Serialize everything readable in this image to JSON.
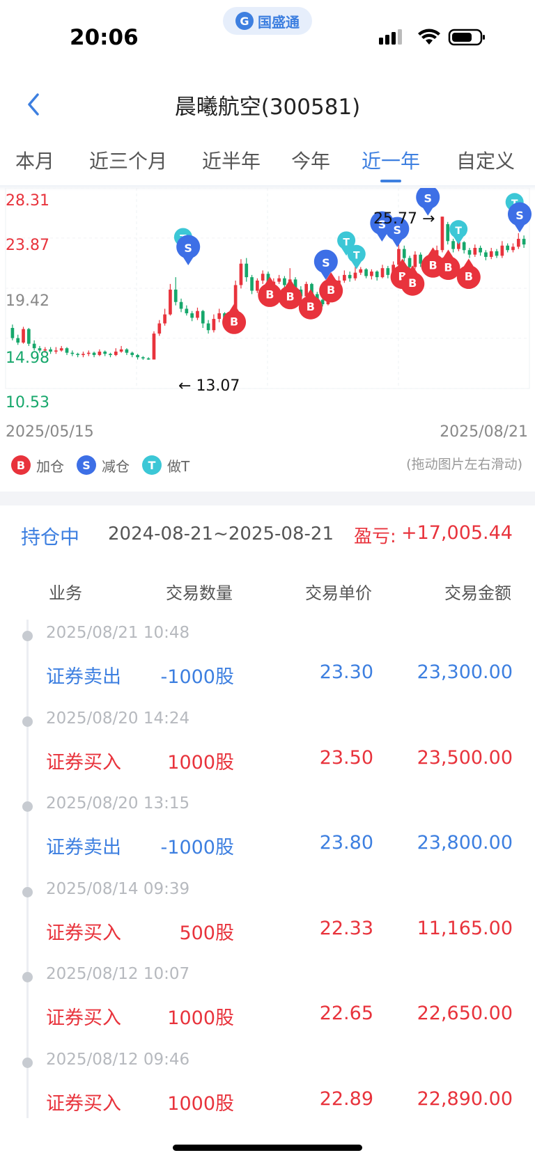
{
  "status_bar": {
    "time": "20:06",
    "carrier_logo": "G",
    "carrier_name": "国盛通",
    "icons": [
      "signal-icon",
      "wifi-icon",
      "battery-icon"
    ]
  },
  "header": {
    "title": "晨曦航空(300581)",
    "back_icon": "chevron-left-icon"
  },
  "tabs": [
    {
      "label": "本月",
      "active": false
    },
    {
      "label": "近三个月",
      "active": false
    },
    {
      "label": "近半年",
      "active": false
    },
    {
      "label": "今年",
      "active": false
    },
    {
      "label": "近一年",
      "active": true
    },
    {
      "label": "自定义",
      "active": false
    }
  ],
  "chart": {
    "y_labels": {
      "high": "28.31",
      "mid1": "23.87",
      "mid2": "19.42",
      "mid3": "14.98",
      "low": "10.53"
    },
    "date_start": "2025/05/15",
    "date_end": "2025/08/21",
    "high_callout": "25.77",
    "low_callout": "13.07",
    "drag_hint": "(拖动图片左右滑动)",
    "colors": {
      "up": "#e8333c",
      "down": "#16a76b",
      "buy": "#e8333c",
      "sell": "#3d6fe6",
      "t": "#3cc7d6"
    }
  },
  "chart_data": {
    "type": "candlestick",
    "x_range": [
      "2025/05/15",
      "2025/08/21"
    ],
    "ylim": [
      10.53,
      28.31
    ],
    "y_ticks": [
      28.31,
      23.87,
      19.42,
      14.98,
      10.53
    ],
    "candles": [
      [
        15.9,
        15.0,
        16.2,
        14.8
      ],
      [
        15.0,
        14.6,
        15.3,
        14.4
      ],
      [
        14.6,
        15.8,
        16.0,
        14.5
      ],
      [
        15.8,
        14.5,
        15.9,
        14.3
      ],
      [
        14.5,
        14.1,
        14.8,
        13.9
      ],
      [
        14.1,
        13.9,
        14.3,
        13.7
      ],
      [
        13.9,
        14.0,
        14.2,
        13.7
      ],
      [
        14.0,
        13.8,
        14.2,
        13.6
      ],
      [
        13.8,
        13.9,
        14.2,
        13.6
      ],
      [
        13.9,
        14.1,
        14.3,
        13.8
      ],
      [
        14.1,
        13.7,
        14.2,
        13.5
      ],
      [
        13.7,
        13.6,
        13.9,
        13.4
      ],
      [
        13.6,
        13.5,
        13.7,
        13.3
      ],
      [
        13.5,
        13.6,
        13.8,
        13.3
      ],
      [
        13.6,
        13.7,
        13.9,
        13.4
      ],
      [
        13.7,
        13.5,
        13.8,
        13.3
      ],
      [
        13.5,
        13.8,
        14.0,
        13.4
      ],
      [
        13.8,
        13.6,
        13.9,
        13.4
      ],
      [
        13.6,
        13.5,
        13.7,
        13.3
      ],
      [
        13.5,
        13.8,
        14.1,
        13.4
      ],
      [
        13.8,
        14.0,
        14.3,
        13.7
      ],
      [
        14.0,
        13.7,
        14.1,
        13.5
      ],
      [
        13.7,
        13.5,
        13.8,
        13.3
      ],
      [
        13.5,
        13.3,
        13.6,
        13.1
      ],
      [
        13.3,
        13.2,
        13.4,
        13.07
      ],
      [
        13.2,
        13.1,
        13.3,
        13.07
      ],
      [
        13.1,
        15.4,
        15.6,
        13.1
      ],
      [
        15.4,
        16.3,
        16.6,
        15.2
      ],
      [
        16.3,
        17.1,
        17.6,
        16.1
      ],
      [
        17.1,
        19.3,
        19.8,
        17.0
      ],
      [
        19.3,
        18.2,
        20.4,
        17.9
      ],
      [
        18.2,
        17.6,
        18.5,
        17.3
      ],
      [
        17.6,
        17.2,
        17.9,
        17.0
      ],
      [
        17.2,
        16.8,
        17.4,
        16.5
      ],
      [
        16.8,
        17.4,
        17.7,
        16.6
      ],
      [
        17.4,
        16.3,
        17.5,
        15.9
      ],
      [
        16.3,
        15.7,
        16.6,
        15.4
      ],
      [
        15.7,
        16.7,
        17.1,
        15.5
      ],
      [
        16.7,
        17.2,
        17.6,
        16.4
      ],
      [
        17.2,
        16.5,
        17.3,
        16.2
      ],
      [
        16.5,
        16.9,
        17.2,
        16.3
      ],
      [
        16.9,
        19.7,
        20.1,
        16.8
      ],
      [
        19.7,
        21.6,
        22.0,
        19.4
      ],
      [
        21.6,
        20.4,
        22.1,
        20.0
      ],
      [
        20.4,
        19.2,
        20.6,
        18.9
      ],
      [
        19.2,
        20.1,
        20.3,
        19.0
      ],
      [
        20.1,
        20.7,
        21.0,
        19.8
      ],
      [
        20.7,
        19.6,
        20.9,
        19.2
      ],
      [
        19.6,
        20.0,
        20.3,
        19.3
      ],
      [
        20.0,
        20.3,
        20.6,
        19.8
      ],
      [
        20.3,
        19.7,
        20.5,
        19.4
      ],
      [
        19.7,
        20.2,
        21.2,
        19.5
      ],
      [
        20.2,
        19.3,
        20.4,
        19.0
      ],
      [
        19.3,
        18.7,
        19.6,
        18.4
      ],
      [
        18.7,
        19.8,
        20.0,
        18.5
      ],
      [
        19.8,
        18.9,
        19.9,
        18.6
      ],
      [
        18.9,
        18.4,
        19.1,
        18.1
      ],
      [
        18.4,
        18.0,
        18.6,
        17.8
      ],
      [
        18.0,
        19.2,
        19.5,
        17.9
      ],
      [
        19.2,
        18.7,
        19.4,
        18.5
      ],
      [
        18.7,
        20.1,
        20.5,
        18.6
      ],
      [
        20.1,
        20.6,
        21.0,
        19.9
      ],
      [
        20.6,
        20.3,
        20.9,
        20.0
      ],
      [
        20.3,
        20.8,
        21.4,
        20.1
      ],
      [
        20.8,
        21.1,
        21.3,
        20.6
      ],
      [
        21.1,
        20.5,
        21.2,
        20.3
      ],
      [
        20.5,
        20.9,
        21.1,
        20.2
      ],
      [
        20.9,
        20.4,
        21.0,
        20.1
      ],
      [
        20.4,
        21.2,
        21.5,
        20.3
      ],
      [
        21.2,
        20.6,
        21.4,
        20.3
      ],
      [
        20.6,
        21.5,
        21.8,
        20.4
      ],
      [
        21.5,
        22.9,
        23.6,
        21.3
      ],
      [
        22.9,
        22.1,
        23.2,
        21.8
      ],
      [
        22.1,
        21.3,
        22.3,
        21.0
      ],
      [
        21.3,
        22.4,
        22.7,
        21.1
      ],
      [
        22.4,
        21.6,
        22.6,
        21.3
      ],
      [
        21.6,
        21.1,
        21.8,
        20.8
      ],
      [
        21.1,
        22.0,
        22.3,
        20.9
      ],
      [
        22.0,
        22.8,
        23.2,
        21.8
      ],
      [
        22.8,
        25.77,
        25.77,
        22.6
      ],
      [
        25.1,
        23.6,
        25.3,
        23.3
      ],
      [
        23.6,
        22.9,
        23.8,
        22.6
      ],
      [
        22.9,
        23.5,
        23.9,
        22.7
      ],
      [
        23.5,
        22.8,
        23.6,
        22.5
      ],
      [
        22.8,
        22.4,
        23.0,
        22.1
      ],
      [
        22.4,
        23.0,
        23.3,
        22.2
      ],
      [
        23.0,
        22.6,
        23.2,
        22.3
      ],
      [
        22.6,
        22.2,
        22.8,
        21.9
      ],
      [
        22.2,
        22.7,
        23.0,
        22.0
      ],
      [
        22.7,
        22.3,
        22.9,
        22.1
      ],
      [
        22.3,
        23.2,
        23.6,
        22.1
      ],
      [
        23.2,
        22.8,
        23.4,
        22.6
      ],
      [
        22.8,
        23.1,
        23.4,
        22.6
      ],
      [
        23.1,
        23.8,
        24.3,
        22.9
      ],
      [
        23.8,
        23.3,
        24.1,
        23.0
      ]
    ],
    "markers": [
      {
        "type": "T",
        "label": "T",
        "x": 0.34,
        "price": 23.9
      },
      {
        "type": "S",
        "label": "S",
        "x": 0.35,
        "price": 23.0
      },
      {
        "type": "B",
        "label": "B",
        "x": 0.44,
        "price": 16.5
      },
      {
        "type": "B",
        "label": "B",
        "x": 0.51,
        "price": 18.9
      },
      {
        "type": "B",
        "label": "B",
        "x": 0.55,
        "price": 18.7
      },
      {
        "type": "B",
        "label": "B",
        "x": 0.59,
        "price": 17.8
      },
      {
        "type": "S",
        "label": "S",
        "x": 0.62,
        "price": 21.7
      },
      {
        "type": "B",
        "label": "B",
        "x": 0.63,
        "price": 19.3
      },
      {
        "type": "T",
        "label": "T",
        "x": 0.66,
        "price": 23.6
      },
      {
        "type": "T",
        "label": "T",
        "x": 0.68,
        "price": 22.4
      },
      {
        "type": "S",
        "label": "S",
        "x": 0.73,
        "price": 25.1
      },
      {
        "type": "S",
        "label": "S",
        "x": 0.76,
        "price": 24.6
      },
      {
        "type": "B",
        "label": "B",
        "x": 0.77,
        "price": 20.5
      },
      {
        "type": "B",
        "label": "B",
        "x": 0.79,
        "price": 19.9
      },
      {
        "type": "S",
        "label": "S",
        "x": 0.82,
        "price": 27.4
      },
      {
        "type": "B",
        "label": "B",
        "x": 0.83,
        "price": 21.5
      },
      {
        "type": "B",
        "label": "B",
        "x": 0.86,
        "price": 21.3
      },
      {
        "type": "T",
        "label": "T",
        "x": 0.88,
        "price": 24.6
      },
      {
        "type": "B",
        "label": "B",
        "x": 0.9,
        "price": 20.5
      },
      {
        "type": "T",
        "label": "T",
        "x": 0.99,
        "price": 27.0
      },
      {
        "type": "S",
        "label": "S",
        "x": 1.0,
        "price": 25.9
      }
    ]
  },
  "legend": [
    {
      "marker": "B",
      "label": "加仓"
    },
    {
      "marker": "S",
      "label": "减仓"
    },
    {
      "marker": "T",
      "label": "做T"
    }
  ],
  "summary": {
    "status": "持仓中",
    "range": "2024-08-21~2025-08-21",
    "pl_label": "盈亏:",
    "pl_value": "+17,005.44"
  },
  "table": {
    "headers": {
      "biz": "业务",
      "qty": "交易数量",
      "price": "交易单价",
      "amount": "交易金额"
    },
    "rows": [
      {
        "time": "2025/08/21 10:48",
        "biz": "证券卖出",
        "side": "sell",
        "qty": "-1000股",
        "price": "23.30",
        "amount": "23,300.00"
      },
      {
        "time": "2025/08/20 14:24",
        "biz": "证券买入",
        "side": "buy",
        "qty": "1000股",
        "price": "23.50",
        "amount": "23,500.00"
      },
      {
        "time": "2025/08/20 13:15",
        "biz": "证券卖出",
        "side": "sell",
        "qty": "-1000股",
        "price": "23.80",
        "amount": "23,800.00"
      },
      {
        "time": "2025/08/14 09:39",
        "biz": "证券买入",
        "side": "buy",
        "qty": "500股",
        "price": "22.33",
        "amount": "11,165.00"
      },
      {
        "time": "2025/08/12 10:07",
        "biz": "证券买入",
        "side": "buy",
        "qty": "1000股",
        "price": "22.65",
        "amount": "22,650.00"
      },
      {
        "time": "2025/08/12 09:46",
        "biz": "证券买入",
        "side": "buy",
        "qty": "1000股",
        "price": "22.89",
        "amount": "22,890.00"
      }
    ]
  }
}
